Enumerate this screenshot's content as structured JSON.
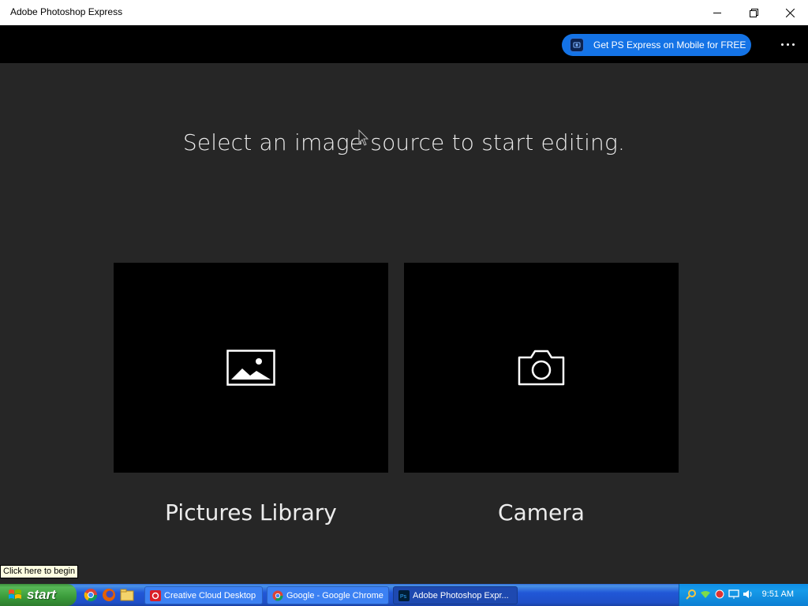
{
  "window": {
    "title": "Adobe Photoshop Express"
  },
  "topbar": {
    "promo_label": "Get PS Express on Mobile for FREE"
  },
  "main": {
    "heading": "Select an image source to start editing.",
    "sources": [
      {
        "label": "Pictures Library",
        "icon": "image-icon"
      },
      {
        "label": "Camera",
        "icon": "camera-icon"
      }
    ]
  },
  "tooltip": "Click here to begin",
  "taskbar": {
    "start_label": "start",
    "tasks": [
      {
        "label": "Creative Cloud Desktop",
        "icon": "creative-cloud-icon"
      },
      {
        "label": "Google - Google Chrome",
        "icon": "chrome-icon"
      },
      {
        "label": "Adobe Photoshop Expr...",
        "icon": "photoshop-icon",
        "active": true
      }
    ],
    "clock": "9:51 AM"
  },
  "colors": {
    "accent": "#1473e6",
    "background": "#262626",
    "tile": "#000000"
  }
}
